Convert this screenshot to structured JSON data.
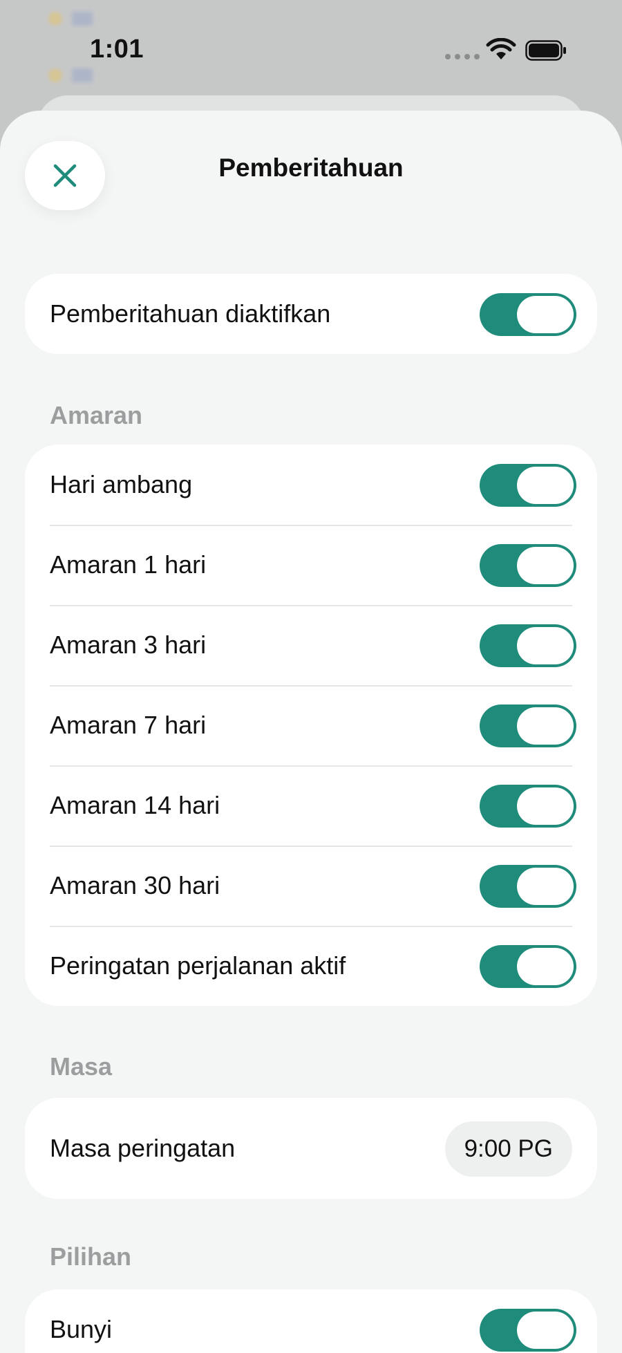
{
  "status_bar": {
    "time": "1:01"
  },
  "sheet": {
    "title": "Pemberitahuan"
  },
  "main_toggle": {
    "label": "Pemberitahuan diaktifkan",
    "on": true
  },
  "sections": {
    "amaran": {
      "title": "Amaran",
      "rows": [
        {
          "label": "Hari ambang",
          "on": true
        },
        {
          "label": "Amaran 1 hari",
          "on": true
        },
        {
          "label": "Amaran 3 hari",
          "on": true
        },
        {
          "label": "Amaran 7 hari",
          "on": true
        },
        {
          "label": "Amaran 14 hari",
          "on": true
        },
        {
          "label": "Amaran 30 hari",
          "on": true
        },
        {
          "label": "Peringatan perjalanan aktif",
          "on": true
        }
      ]
    },
    "masa": {
      "title": "Masa",
      "row": {
        "label": "Masa peringatan",
        "value": "9:00 PG"
      }
    },
    "pilihan": {
      "title": "Pilihan",
      "rows": [
        {
          "label": "Bunyi",
          "on": true
        }
      ]
    }
  },
  "colors": {
    "accent": "#1f8b7b",
    "sheet_bg": "#f4f6f6",
    "card_bg": "#ffffff",
    "section_label": "#9b9e9e"
  }
}
